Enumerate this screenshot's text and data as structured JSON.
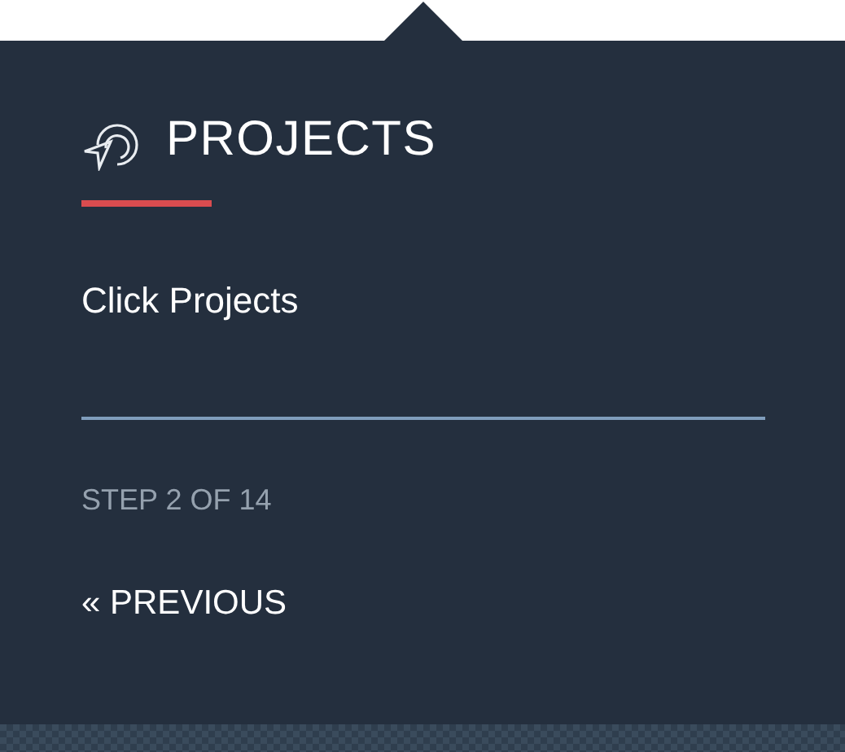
{
  "popover": {
    "title": "PROJECTS",
    "instruction": "Click Projects",
    "step": "STEP 2 OF 14",
    "previous_link": "« PREVIOUS"
  }
}
